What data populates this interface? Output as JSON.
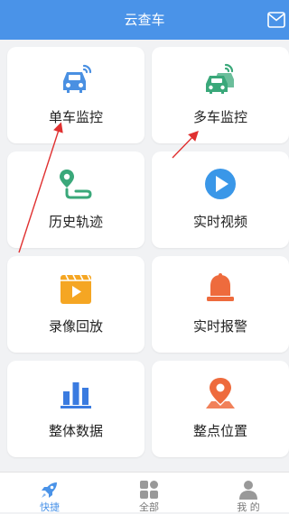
{
  "header": {
    "title": "云查车",
    "mail_icon": "mail-icon"
  },
  "cards": [
    {
      "label": "单车监控",
      "icon": "car-signal-icon",
      "color": "#4a90e2"
    },
    {
      "label": "多车监控",
      "icon": "multi-car-signal-icon",
      "color": "#3aa87a"
    },
    {
      "label": "历史轨迹",
      "icon": "route-pin-icon",
      "color": "#3aa87a"
    },
    {
      "label": "实时视频",
      "icon": "play-circle-icon",
      "color": "#3a97e8"
    },
    {
      "label": "录像回放",
      "icon": "video-clapper-icon",
      "color": "#f5a623"
    },
    {
      "label": "实时报警",
      "icon": "alarm-bell-icon",
      "color": "#ee6b3d"
    },
    {
      "label": "整体数据",
      "icon": "bar-chart-icon",
      "color": "#3a7be0"
    },
    {
      "label": "整点位置",
      "icon": "location-pin-icon",
      "color": "#ee6b3d"
    }
  ],
  "tabbar": [
    {
      "label": "快捷",
      "icon": "rocket-icon",
      "active": true
    },
    {
      "label": "全部",
      "icon": "grid-icon",
      "active": false
    },
    {
      "label": "我 的",
      "icon": "user-icon",
      "active": false
    }
  ],
  "colors": {
    "header": "#4a93e8",
    "active_tab": "#4a93e8",
    "annotation": "#e03030"
  }
}
